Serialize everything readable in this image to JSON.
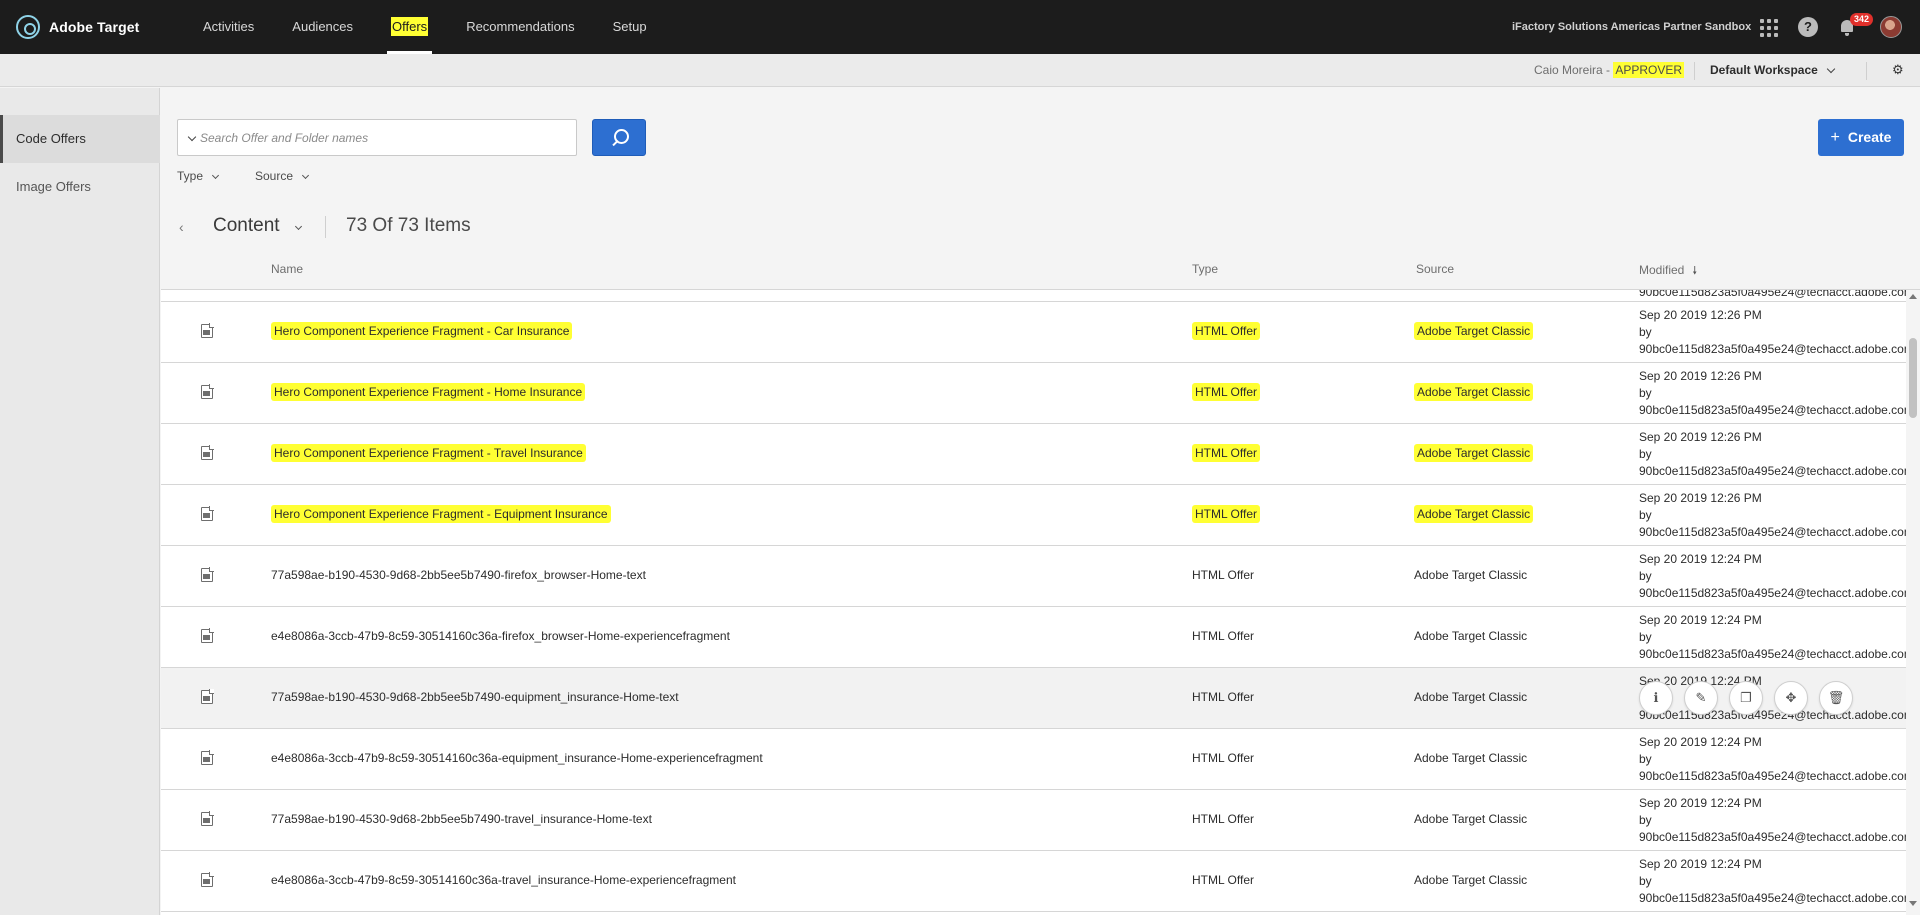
{
  "app": {
    "name": "Adobe Target"
  },
  "nav": [
    {
      "label": "Activities",
      "active": false
    },
    {
      "label": "Audiences",
      "active": false
    },
    {
      "label": "Offers",
      "active": true
    },
    {
      "label": "Recommendations",
      "active": false
    },
    {
      "label": "Setup",
      "active": false
    }
  ],
  "topbar": {
    "org": "iFactory Solutions Americas Partner Sandbox",
    "help_glyph": "?",
    "notification_count": "342"
  },
  "subbar": {
    "user_name": "Caio Moreira - ",
    "user_role": "APPROVER",
    "workspace": "Default Workspace",
    "settings_glyph": "⚙"
  },
  "sidebar": {
    "items": [
      {
        "label": "Code Offers",
        "active": true
      },
      {
        "label": "Image Offers",
        "active": false
      }
    ]
  },
  "search": {
    "placeholder": "Search Offer and Folder names",
    "value": ""
  },
  "create_button": {
    "plus": "+",
    "label": "Create"
  },
  "filters": {
    "type": "Type",
    "source": "Source"
  },
  "breadcrumb": {
    "back": "‹",
    "folder": "Content",
    "count": "73 Of 73 Items"
  },
  "columns": {
    "name": "Name",
    "type": "Type",
    "source": "Source",
    "modified": "Modified",
    "sort_glyph": "🠗"
  },
  "partial_row_modified": "90bc0e115d823a5f0a495e24@techacct.adobe.com",
  "highlight_color": "#ffff33",
  "accent_color": "#2d6fd1",
  "rows": [
    {
      "name": "Hero Component Experience Fragment - Car Insurance",
      "type": "HTML Offer",
      "source": "Adobe Target Classic",
      "date": "Sep 20 2019  12:26 PM",
      "by": "by",
      "user": "90bc0e115d823a5f0a495e24@techacct.adobe.com",
      "highlighted": true,
      "hover": false
    },
    {
      "name": "Hero Component Experience Fragment - Home Insurance",
      "type": "HTML Offer",
      "source": "Adobe Target Classic",
      "date": "Sep 20 2019  12:26 PM",
      "by": "by",
      "user": "90bc0e115d823a5f0a495e24@techacct.adobe.com",
      "highlighted": true,
      "hover": false
    },
    {
      "name": "Hero Component Experience Fragment - Travel Insurance",
      "type": "HTML Offer",
      "source": "Adobe Target Classic",
      "date": "Sep 20 2019  12:26 PM",
      "by": "by",
      "user": "90bc0e115d823a5f0a495e24@techacct.adobe.com",
      "highlighted": true,
      "hover": false
    },
    {
      "name": "Hero Component Experience Fragment - Equipment Insurance",
      "type": "HTML Offer",
      "source": "Adobe Target Classic",
      "date": "Sep 20 2019  12:26 PM",
      "by": "by",
      "user": "90bc0e115d823a5f0a495e24@techacct.adobe.com",
      "highlighted": true,
      "hover": false
    },
    {
      "name": "77a598ae-b190-4530-9d68-2bb5ee5b7490-firefox_browser-Home-text",
      "type": "HTML Offer",
      "source": "Adobe Target Classic",
      "date": "Sep 20 2019  12:24 PM",
      "by": "by",
      "user": "90bc0e115d823a5f0a495e24@techacct.adobe.com",
      "highlighted": false,
      "hover": false
    },
    {
      "name": "e4e8086a-3ccb-47b9-8c59-30514160c36a-firefox_browser-Home-experiencefragment",
      "type": "HTML Offer",
      "source": "Adobe Target Classic",
      "date": "Sep 20 2019  12:24 PM",
      "by": "by",
      "user": "90bc0e115d823a5f0a495e24@techacct.adobe.com",
      "highlighted": false,
      "hover": false
    },
    {
      "name": "77a598ae-b190-4530-9d68-2bb5ee5b7490-equipment_insurance-Home-text",
      "type": "HTML Offer",
      "source": "Adobe Target Classic",
      "date": "Sep 20 2019  12:24 PM",
      "by": "by",
      "user": "90bc0e115d823a5f0a495e24@techacct.adobe.com",
      "highlighted": false,
      "hover": true
    },
    {
      "name": "e4e8086a-3ccb-47b9-8c59-30514160c36a-equipment_insurance-Home-experiencefragment",
      "type": "HTML Offer",
      "source": "Adobe Target Classic",
      "date": "Sep 20 2019  12:24 PM",
      "by": "by",
      "user": "90bc0e115d823a5f0a495e24@techacct.adobe.com",
      "highlighted": false,
      "hover": false
    },
    {
      "name": "77a598ae-b190-4530-9d68-2bb5ee5b7490-travel_insurance-Home-text",
      "type": "HTML Offer",
      "source": "Adobe Target Classic",
      "date": "Sep 20 2019  12:24 PM",
      "by": "by",
      "user": "90bc0e115d823a5f0a495e24@techacct.adobe.com",
      "highlighted": false,
      "hover": false
    },
    {
      "name": "e4e8086a-3ccb-47b9-8c59-30514160c36a-travel_insurance-Home-experiencefragment",
      "type": "HTML Offer",
      "source": "Adobe Target Classic",
      "date": "Sep 20 2019  12:24 PM",
      "by": "by",
      "user": "90bc0e115d823a5f0a495e24@techacct.adobe.com",
      "highlighted": false,
      "hover": false
    }
  ],
  "row_actions": [
    {
      "name": "info-icon",
      "glyph": "ℹ"
    },
    {
      "name": "edit-icon",
      "glyph": "✎"
    },
    {
      "name": "copy-icon",
      "glyph": "❐"
    },
    {
      "name": "move-icon",
      "glyph": "✥"
    },
    {
      "name": "delete-icon",
      "glyph": "🗑"
    }
  ]
}
